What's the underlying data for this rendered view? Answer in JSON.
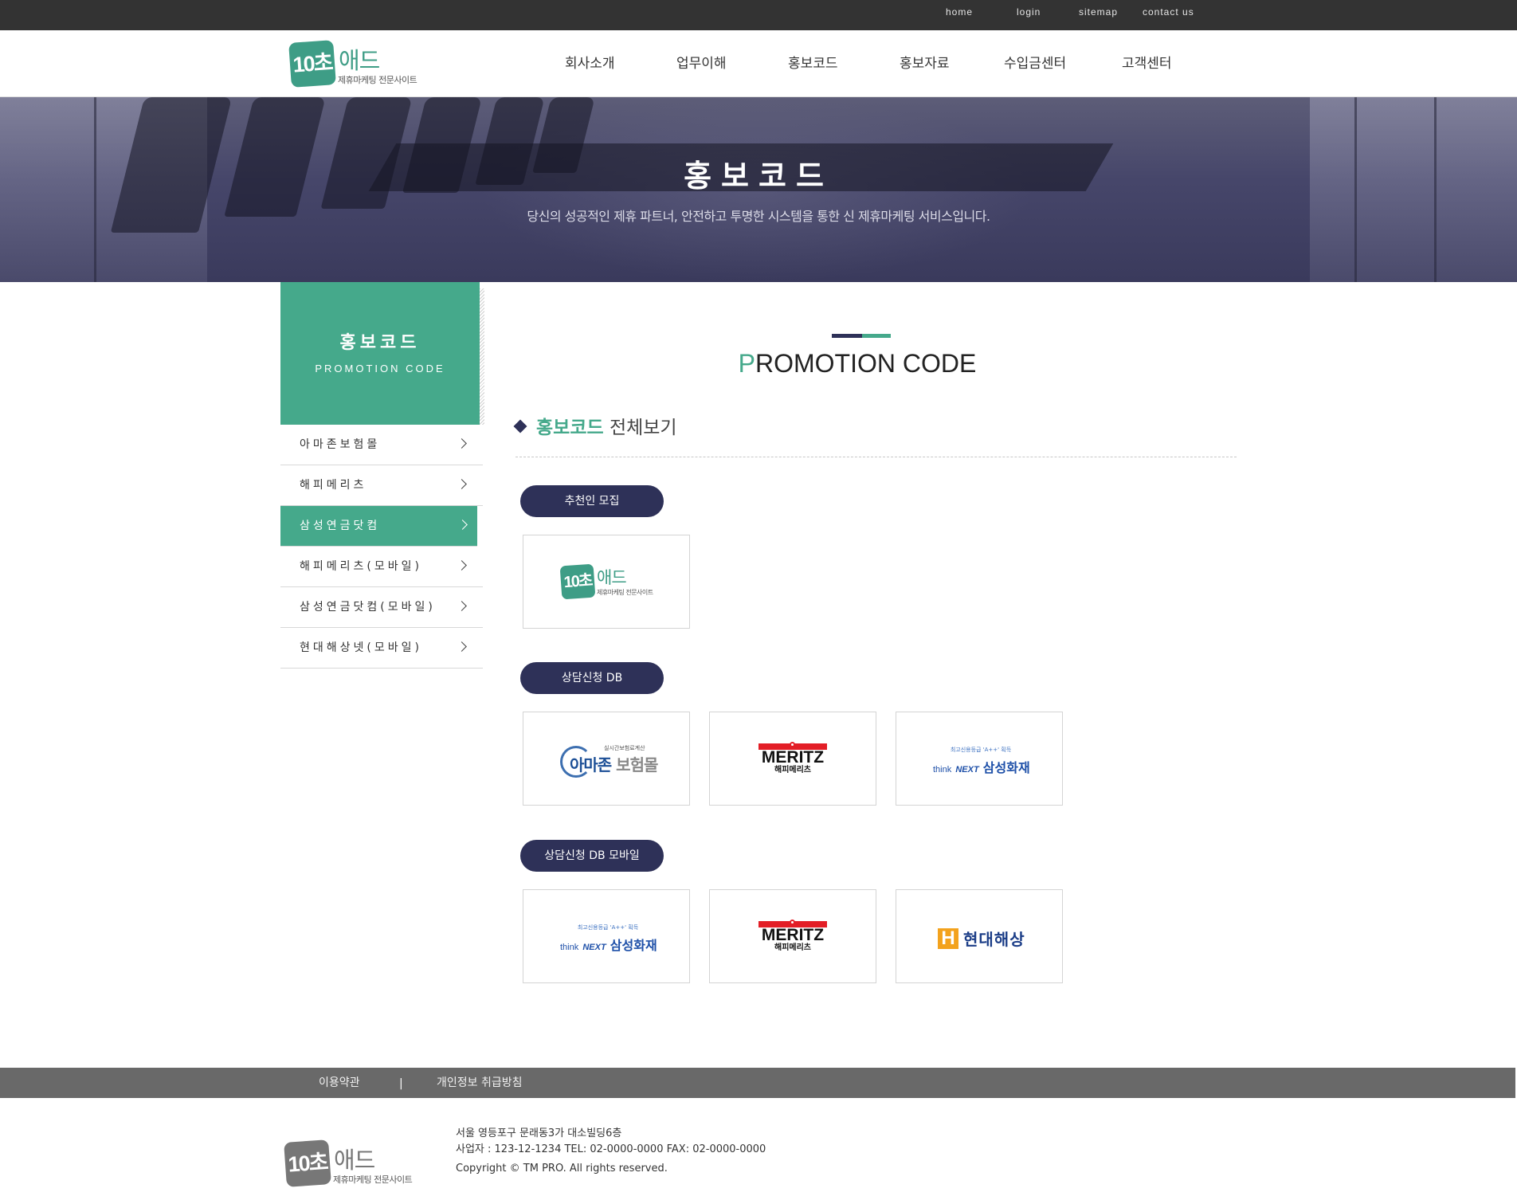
{
  "topbar": {
    "links": [
      "home",
      "login",
      "sitemap",
      "contact us"
    ]
  },
  "brand": {
    "badge": "10초",
    "word": "애드",
    "sub": "제휴마케팅 전문사이트"
  },
  "gnb": [
    "회사소개",
    "업무이해",
    "홍보코드",
    "홍보자료",
    "수입금센터",
    "고객센터"
  ],
  "hero": {
    "title": "홍보코드",
    "subtitle": "당신의 성공적인 제휴 파트너, 안전하고 투명한 시스템을 통한 신 제휴마케팅 서비스입니다."
  },
  "sidebar": {
    "title": "홍보코드",
    "subtitle": "PROMOTION CODE",
    "items": [
      {
        "label": "아마존보험몰",
        "active": false
      },
      {
        "label": "해피메리츠",
        "active": false
      },
      {
        "label": "삼성연금닷컴",
        "active": true
      },
      {
        "label": "해피메리츠(모바일)",
        "active": false
      },
      {
        "label": "삼성연금닷컴(모바일)",
        "active": false
      },
      {
        "label": "현대해상넷(모바일)",
        "active": false
      }
    ]
  },
  "main": {
    "title_first": "P",
    "title_rest": "ROMOTION CODE",
    "section_highlight": "홍보코드",
    "section_rest": " 전체보기",
    "groups": [
      {
        "label": "추천인 모집"
      },
      {
        "label": "상담신청 DB"
      },
      {
        "label": "상담신청 DB 모바일"
      }
    ],
    "logos": {
      "amazon_tag": "실시간보험료계산",
      "amazon_a": "아마존",
      "amazon_b": " 보험몰",
      "meritz": "MERITZ",
      "meritz_kr": "해피메리츠",
      "samsung_tag": "최고신용등급 'A++' 획득",
      "samsung_think": "think",
      "samsung_next": "NEXT",
      "samsung_name": "삼성화재",
      "hyundai_h": "H",
      "hyundai_name": "현대해상"
    }
  },
  "footer": {
    "links": [
      "이용약관",
      "개인정보 취급방침"
    ],
    "separator": "|",
    "address": "서울 영등포구 문래동3가 대소빌딩6층",
    "business": "사업자 : 123-12-1234 TEL: 02-0000-0000 FAX: 02-0000-0000",
    "copyright": "Copyright © TM PRO. All rights reserved."
  },
  "colors": {
    "accent_green": "#45a98b",
    "navy": "#2e3158",
    "topbar": "#333333",
    "footer_bar": "#696969"
  }
}
